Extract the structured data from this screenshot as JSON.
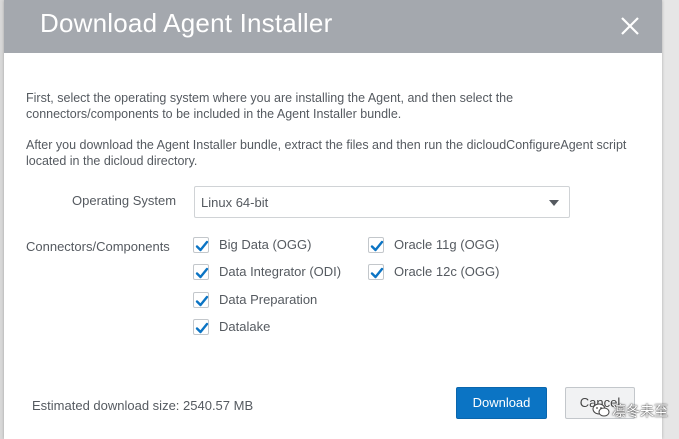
{
  "dialog": {
    "title": "Download Agent Installer",
    "close_icon": "close-icon",
    "intro_text": "First, select the operating system where you are installing the Agent, and then select the connectors/components to be included in the Agent Installer bundle.",
    "instructions_text": "After you download the Agent Installer bundle, extract the files and then run the dicloudConfigureAgent script located in the dicloud directory."
  },
  "form": {
    "os_label": "Operating System",
    "os_selected": "Linux 64-bit",
    "components_label": "Connectors/Components",
    "components": [
      {
        "label": "Big Data (OGG)",
        "checked": true
      },
      {
        "label": "Data Integrator (ODI)",
        "checked": true
      },
      {
        "label": "Data Preparation",
        "checked": true
      },
      {
        "label": "Datalake",
        "checked": true
      },
      {
        "label": "Oracle 11g (OGG)",
        "checked": true
      },
      {
        "label": "Oracle 12c (OGG)",
        "checked": true
      }
    ]
  },
  "footer": {
    "estimate_text": "Estimated download size: 2540.57 MB",
    "download_label": "Download",
    "cancel_label": "Cancel"
  },
  "watermark": {
    "text": "凛冬未至"
  },
  "colors": {
    "header_bg": "#a4a8ae",
    "primary_button": "#0b74c4",
    "checkmark": "#0b74c4",
    "text": "#555a60"
  }
}
